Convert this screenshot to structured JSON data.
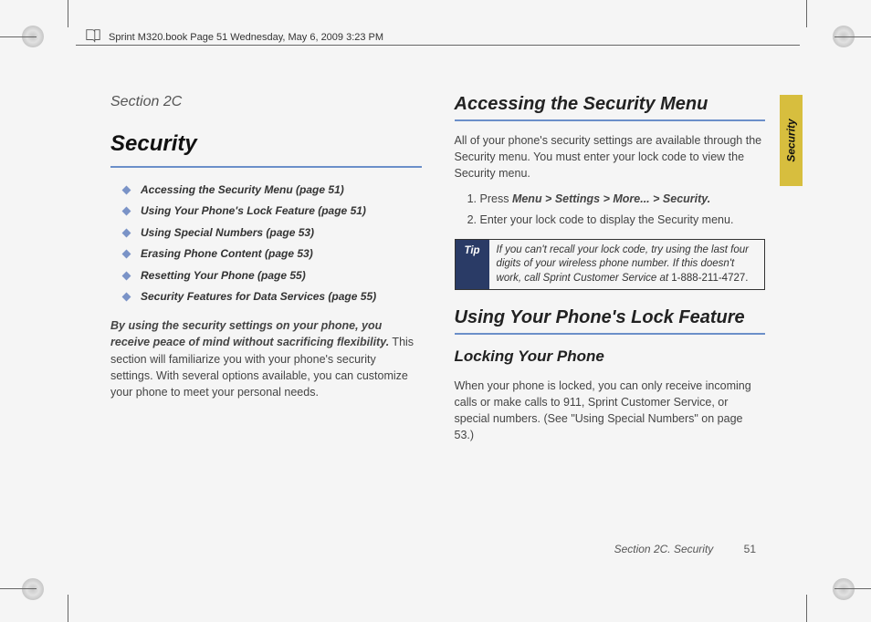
{
  "header": {
    "text": "Sprint M320.book  Page 51  Wednesday, May 6, 2009  3:23 PM"
  },
  "side_tab": {
    "label": "Security"
  },
  "left": {
    "section_label": "Section 2C",
    "title": "Security",
    "toc": [
      "Accessing the Security Menu (page 51)",
      "Using Your Phone's Lock Feature (page 51)",
      "Using Special Numbers (page 53)",
      "Erasing Phone Content (page 53)",
      "Resetting Your Phone (page 55)",
      "Security Features for Data Services (page 55)"
    ],
    "intro_lead": "By using the security settings on your phone, you receive peace of mind without sacrificing flexibility.",
    "intro_rest": " This section will familiarize you with your phone's security settings. With several options available, you can customize your phone to meet your personal needs."
  },
  "right": {
    "h2_1": "Accessing the Security Menu",
    "p1": "All of your phone's security settings are available through the Security menu. You must enter your lock code to view the Security menu.",
    "step1_prefix": "Press ",
    "step1_path": "Menu > Settings > More... > Security.",
    "step2": "Enter your lock code to display the Security menu.",
    "tip_label": "Tip",
    "tip_body": "If you can't recall your lock code, try using the last four digits of your wireless phone number. If this doesn't work, call Sprint Customer Service at ",
    "tip_phone": "1-888-211-4727.",
    "h2_2": "Using Your Phone's Lock Feature",
    "h3_1": "Locking Your Phone",
    "p2": "When your phone is locked, you can only receive incoming calls or make calls to 911, Sprint Customer Service, or special numbers. (See \"Using Special Numbers\" on page 53.)"
  },
  "footer": {
    "section": "Section 2C. Security",
    "page": "51"
  }
}
